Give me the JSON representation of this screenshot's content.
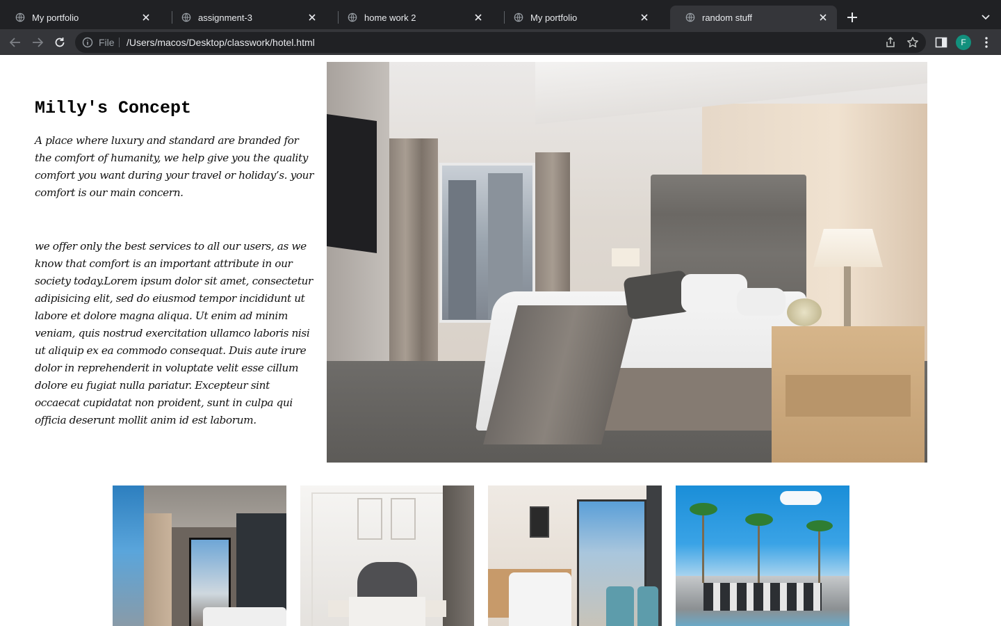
{
  "browser": {
    "tabs": [
      {
        "title": "My portfolio",
        "active": false
      },
      {
        "title": "assignment-3",
        "active": false
      },
      {
        "title": "home work 2",
        "active": false
      },
      {
        "title": "My portfolio",
        "active": false
      },
      {
        "title": "random stuff",
        "active": true
      }
    ],
    "address_bar": {
      "scheme_label": "File",
      "url": "/Users/macos/Desktop/classwork/hotel.html"
    },
    "profile_initial": "F",
    "colors": {
      "chrome_dark": "#202124",
      "chrome_toolbar": "#35363a",
      "avatar": "#12907d"
    }
  },
  "page": {
    "headline": "Milly's Concept",
    "paragraph_1": "A place where luxury and standard are branded for the comfort of humanity, we help give you the quality comfort you want during your travel or holiday’s. your comfort is our main concern.",
    "paragraph_2": "we offer only the best services to all our users, as we know that comfort is an important attribute in our society today.Lorem ipsum dolor sit amet, consectetur adipisicing elit, sed do eiusmod tempor incididunt ut labore et dolore magna aliqua. Ut enim ad minim veniam, quis nostrud exercitation ullamco laboris nisi ut aliquip ex ea commodo consequat. Duis aute irure dolor in reprehenderit in voluptate velit esse cillum dolore eu fugiat nulla pariatur. Excepteur sint occaecat cupidatat non proident, sunt in culpa qui officia deserunt mollit anim id est laborum.",
    "images": {
      "hero": "hotel-bedroom-photo",
      "thumbnails": [
        "loft-bedroom-photo",
        "classic-bedroom-photo",
        "city-view-room-photo",
        "resort-poolside-photo"
      ]
    }
  }
}
